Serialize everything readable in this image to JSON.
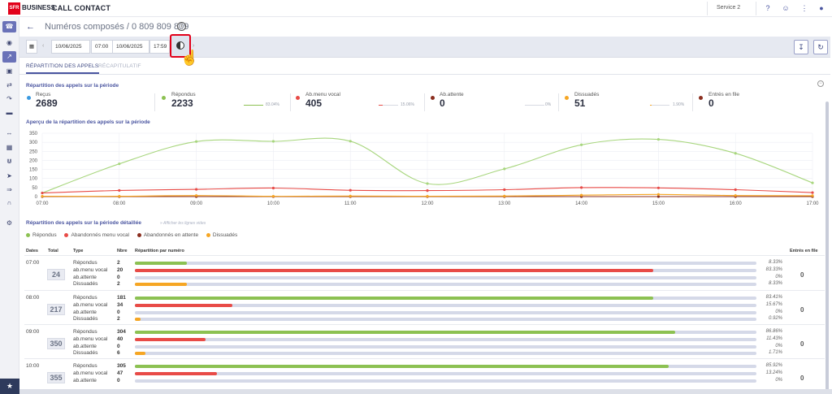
{
  "header": {
    "logo": "SFR",
    "brand": "BUSINESS",
    "title": "CALL CONTACT",
    "service": "Service 2",
    "icons": [
      "help-icon",
      "users-icon",
      "apps-grid-icon",
      "account-icon"
    ]
  },
  "sidebar": {
    "icons": [
      "headset-icon",
      "eye-icon",
      "trend-icon",
      "save-icon",
      "inbox-icon",
      "phone-forward-icon",
      "split-icon",
      "folder-icon",
      "swap-icon",
      "calendar-icon",
      "merge-icon",
      "arrow-icon",
      "phone-transfer-icon",
      "support-icon",
      "settings-icon",
      "star-icon"
    ]
  },
  "breadcrumb": {
    "text": "Numéros composés / 0 809 809 809"
  },
  "toolbar": {
    "date_from": "10/06/2025",
    "time_from": "07:00",
    "date_to": "10/06/2025",
    "time_to": "17:59"
  },
  "tabs": [
    {
      "label": "RÉPARTITION DES APPELS"
    },
    {
      "label": "RÉCAPITULATIF"
    }
  ],
  "summary": {
    "title": "Répartition des appels sur la période",
    "kpis": [
      {
        "label": "Reçus",
        "value": "2689",
        "color": "#3b9ae0",
        "pct": ""
      },
      {
        "label": "Répondus",
        "value": "2233",
        "color": "#8cc152",
        "pct": "83.04%"
      },
      {
        "label": "Ab.menu vocal",
        "value": "405",
        "color": "#e84b47",
        "pct": "15.06%"
      },
      {
        "label": "Ab.attente",
        "value": "0",
        "color": "#8b2e1f",
        "pct": "0%"
      },
      {
        "label": "Dissuadés",
        "value": "51",
        "color": "#f6a623",
        "pct": "1.90%"
      },
      {
        "label": "Entrés en file",
        "value": "0",
        "color": "#8b2e1f",
        "pct": ""
      }
    ]
  },
  "overview": {
    "title": "Aperçu de la répartition des appels sur la période"
  },
  "chart_data": {
    "type": "line",
    "categories": [
      "07:00",
      "08:00",
      "09:00",
      "10:00",
      "11:00",
      "12:00",
      "13:00",
      "14:00",
      "15:00",
      "16:00",
      "17:00"
    ],
    "series": [
      {
        "name": "Répondus",
        "color": "#a8d67e",
        "values": [
          20,
          181,
          304,
          305,
          306,
          72,
          153,
          286,
          316,
          239,
          76
        ]
      },
      {
        "name": "Abandonnés menu vocal",
        "color": "#e84b47",
        "values": [
          20,
          34,
          40,
          47,
          35,
          33,
          38,
          50,
          48,
          38,
          22
        ]
      },
      {
        "name": "Abandonnés en attente",
        "color": "#8b2e1f",
        "values": [
          0,
          0,
          0,
          0,
          0,
          0,
          0,
          0,
          0,
          0,
          0
        ]
      },
      {
        "name": "Dissuadés",
        "color": "#f6a623",
        "values": [
          2,
          2,
          6,
          2,
          3,
          2,
          3,
          8,
          12,
          6,
          5
        ]
      }
    ],
    "ylim": [
      0,
      350
    ],
    "yticks": [
      "350",
      "300",
      "250",
      "200",
      "150",
      "100",
      "50",
      "0"
    ]
  },
  "detail": {
    "title": "Répartition des appels sur la période détaillée",
    "hint": "» Afficher les lignes vides",
    "legend": [
      {
        "label": "Répondus",
        "color": "#8cc152"
      },
      {
        "label": "Abandonnés menu vocal",
        "color": "#e84b47"
      },
      {
        "label": "Abandonnés en attente",
        "color": "#8b2e1f"
      },
      {
        "label": "Dissuadés",
        "color": "#f6a623"
      }
    ],
    "columns": [
      "Dates",
      "Total",
      "Type",
      "Nbre",
      "Répartition par numéro",
      "Entrés en file"
    ],
    "rows": [
      {
        "hour": "07:00",
        "total": "24",
        "entres": "0",
        "lines": [
          {
            "label": "Répondus",
            "nb": "2",
            "pct": "8.33%",
            "frac": 0.0833,
            "color": "#8cc152"
          },
          {
            "label": "ab.menu vocal",
            "nb": "20",
            "pct": "83.33%",
            "frac": 0.8333,
            "color": "#e84b47"
          },
          {
            "label": "ab.attente",
            "nb": "0",
            "pct": "0%",
            "frac": 0,
            "color": "#8b2e1f"
          },
          {
            "label": "Dissuadés",
            "nb": "2",
            "pct": "8.33%",
            "frac": 0.0833,
            "color": "#f6a623"
          }
        ]
      },
      {
        "hour": "08:00",
        "total": "217",
        "entres": "0",
        "lines": [
          {
            "label": "Répondus",
            "nb": "181",
            "pct": "83.41%",
            "frac": 0.8341,
            "color": "#8cc152"
          },
          {
            "label": "ab.menu vocal",
            "nb": "34",
            "pct": "15.67%",
            "frac": 0.1567,
            "color": "#e84b47"
          },
          {
            "label": "ab.attente",
            "nb": "0",
            "pct": "0%",
            "frac": 0,
            "color": "#8b2e1f"
          },
          {
            "label": "Dissuadés",
            "nb": "2",
            "pct": "0.92%",
            "frac": 0.0092,
            "color": "#f6a623"
          }
        ]
      },
      {
        "hour": "09:00",
        "total": "350",
        "entres": "0",
        "lines": [
          {
            "label": "Répondus",
            "nb": "304",
            "pct": "86.86%",
            "frac": 0.8686,
            "color": "#8cc152"
          },
          {
            "label": "ab.menu vocal",
            "nb": "40",
            "pct": "11.43%",
            "frac": 0.1143,
            "color": "#e84b47"
          },
          {
            "label": "ab.attente",
            "nb": "0",
            "pct": "0%",
            "frac": 0,
            "color": "#8b2e1f"
          },
          {
            "label": "Dissuadés",
            "nb": "6",
            "pct": "1.71%",
            "frac": 0.0171,
            "color": "#f6a623"
          }
        ]
      },
      {
        "hour": "10:00",
        "total": "355",
        "entres": "0",
        "lines": [
          {
            "label": "Répondus",
            "nb": "305",
            "pct": "85.92%",
            "frac": 0.8592,
            "color": "#8cc152"
          },
          {
            "label": "ab.menu vocal",
            "nb": "47",
            "pct": "13.24%",
            "frac": 0.1324,
            "color": "#e84b47"
          },
          {
            "label": "ab.attente",
            "nb": "0",
            "pct": "0%",
            "frac": 0,
            "color": "#8b2e1f"
          }
        ]
      }
    ]
  }
}
